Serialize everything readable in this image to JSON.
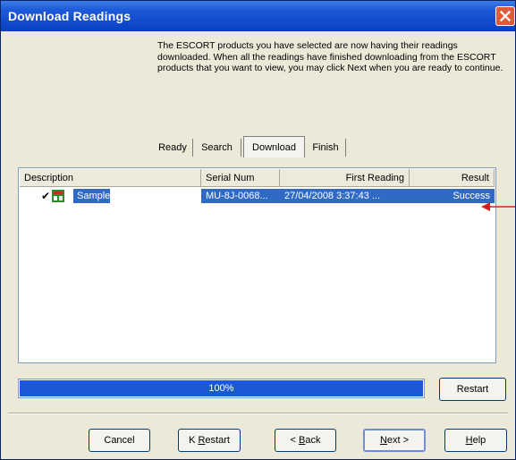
{
  "window": {
    "title": "Download Readings",
    "intro": "The ESCORT products you have selected are now having their readings downloaded. When all the readings have finished downloading from the ESCORT products that you want to view, you may click Next when you are ready to continue."
  },
  "tabs": [
    {
      "label": "Ready"
    },
    {
      "label": "Search"
    },
    {
      "label": "Download",
      "active": true
    },
    {
      "label": "Finish"
    }
  ],
  "list": {
    "columns": [
      "Description",
      "Serial Num",
      "First Reading",
      "Result"
    ],
    "rows": [
      {
        "name": "Sample",
        "serial": "MU-8J-0068...",
        "first_reading": "27/04/2008  3:37:43 ...",
        "result": "Success"
      }
    ]
  },
  "progress": {
    "percent": 100,
    "label": "100%"
  },
  "buttons": {
    "restart": "Restart",
    "cancel": "Cancel",
    "k_restart_prefix": "K ",
    "k_restart_u": "R",
    "k_restart_rest": "estart",
    "back_prefix": "< ",
    "back_u": "B",
    "back_rest": "ack",
    "next_u": "N",
    "next_rest": "ext >",
    "help_u": "H",
    "help_rest": "elp"
  },
  "colors": {
    "accent": "#316ac5",
    "progress": "#1b58d9",
    "annotation": "#d62020"
  },
  "icons": {
    "device": "escort-logger-icon",
    "check": "checkmark-icon",
    "close": "close-icon"
  }
}
